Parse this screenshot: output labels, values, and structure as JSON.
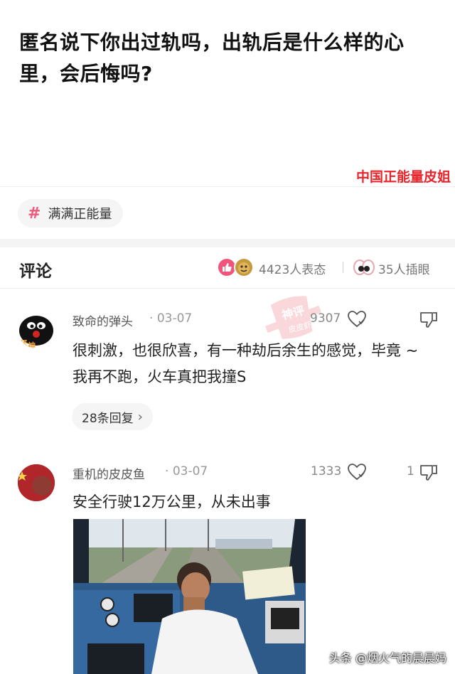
{
  "post": {
    "title": "匿名说下你出过轨吗，出轨后是什么样的心里，会后悔吗?",
    "watermark": "中国正能量皮姐"
  },
  "topic": {
    "label": "满满正能量",
    "icon": "hash-icon"
  },
  "comments_section": {
    "title": "评论",
    "reactions_count": "4423人表态",
    "eye_count": "35人插眼"
  },
  "comments": [
    {
      "username": "致命的弹头",
      "date": "03-07",
      "likes": "9307",
      "text": "很刺激，也很欣喜，有一种劫后余生的感觉，毕竟 ~ 我再不跑，火车真把我撞S",
      "replies": "28条回复"
    },
    {
      "username": "重机的皮皮鱼",
      "date": "03-07",
      "likes": "1333",
      "dislikes": "1",
      "text": "安全行驶12万公里，从未出事"
    }
  ],
  "stamp_text": {
    "top": "神评",
    "bottom": "皮皮虾"
  },
  "source_watermark": "头条 @烟火气的晨晨妈",
  "colors": {
    "accent_pink": "#f0587d",
    "watermark_red": "#e8242b"
  }
}
